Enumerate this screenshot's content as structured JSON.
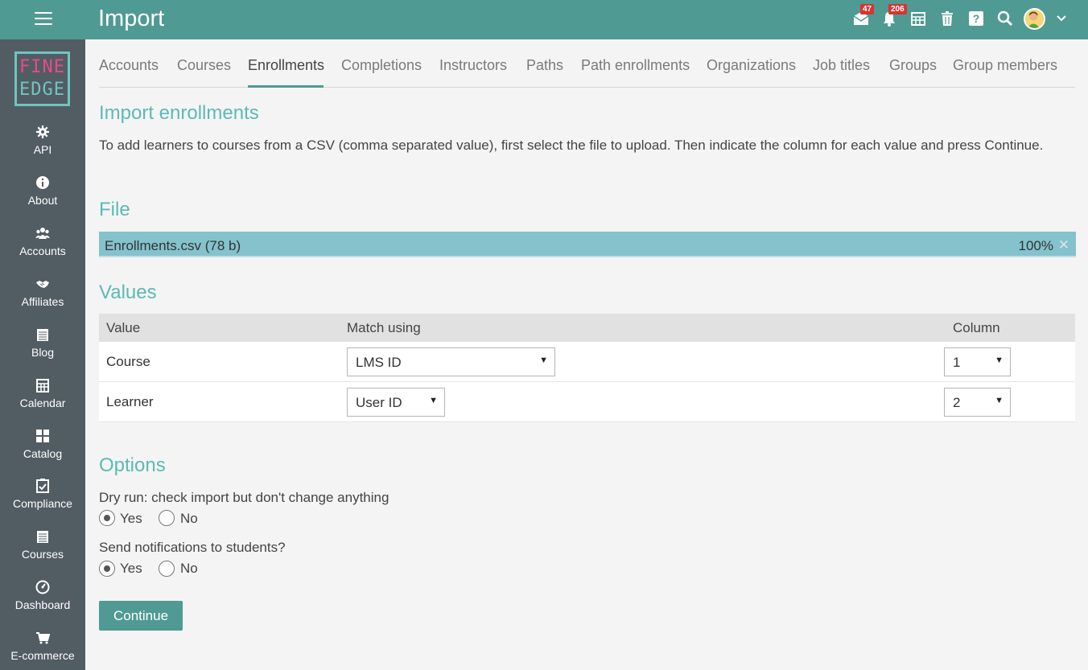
{
  "header": {
    "title": "Import",
    "mail_badge": "47",
    "notifications_badge": "206"
  },
  "sidebar": {
    "logo_line1": "FINE",
    "logo_line2": "EDGE",
    "items": [
      {
        "label": "API",
        "icon": "gear-icon"
      },
      {
        "label": "About",
        "icon": "info-icon"
      },
      {
        "label": "Accounts",
        "icon": "users-icon"
      },
      {
        "label": "Affiliates",
        "icon": "handshake-icon"
      },
      {
        "label": "Blog",
        "icon": "blog-icon"
      },
      {
        "label": "Calendar",
        "icon": "calendar-icon"
      },
      {
        "label": "Catalog",
        "icon": "grid-icon"
      },
      {
        "label": "Compliance",
        "icon": "clipboard-check-icon"
      },
      {
        "label": "Courses",
        "icon": "courses-icon"
      },
      {
        "label": "Dashboard",
        "icon": "dashboard-icon"
      },
      {
        "label": "E-commerce",
        "icon": "cart-icon"
      }
    ]
  },
  "tabs": [
    "Accounts",
    "Courses",
    "Enrollments",
    "Completions",
    "Instructors",
    "Paths",
    "Path enrollments",
    "Organizations",
    "Job titles",
    "Groups",
    "Group members"
  ],
  "main": {
    "heading": "Import enrollments",
    "description": "To add learners to courses from a CSV (comma separated value), first select the file to upload. Then indicate the column for each value and press Continue.",
    "file_heading": "File",
    "file": {
      "name": "Enrollments.csv (78 b)",
      "progress": "100%",
      "close": "✕"
    },
    "values_heading": "Values",
    "table": {
      "headers": {
        "value": "Value",
        "match": "Match using",
        "column": "Column"
      },
      "rows": [
        {
          "value": "Course",
          "match": "LMS ID",
          "column": "1"
        },
        {
          "value": "Learner",
          "match": "User ID",
          "column": "2"
        }
      ]
    },
    "options_heading": "Options",
    "dry_run": {
      "label": "Dry run: check import but don't change anything",
      "yes": "Yes",
      "no": "No",
      "selected": "Yes"
    },
    "notify": {
      "label": "Send notifications to students?",
      "yes": "Yes",
      "no": "No",
      "selected": "Yes"
    },
    "continue_label": "Continue"
  }
}
